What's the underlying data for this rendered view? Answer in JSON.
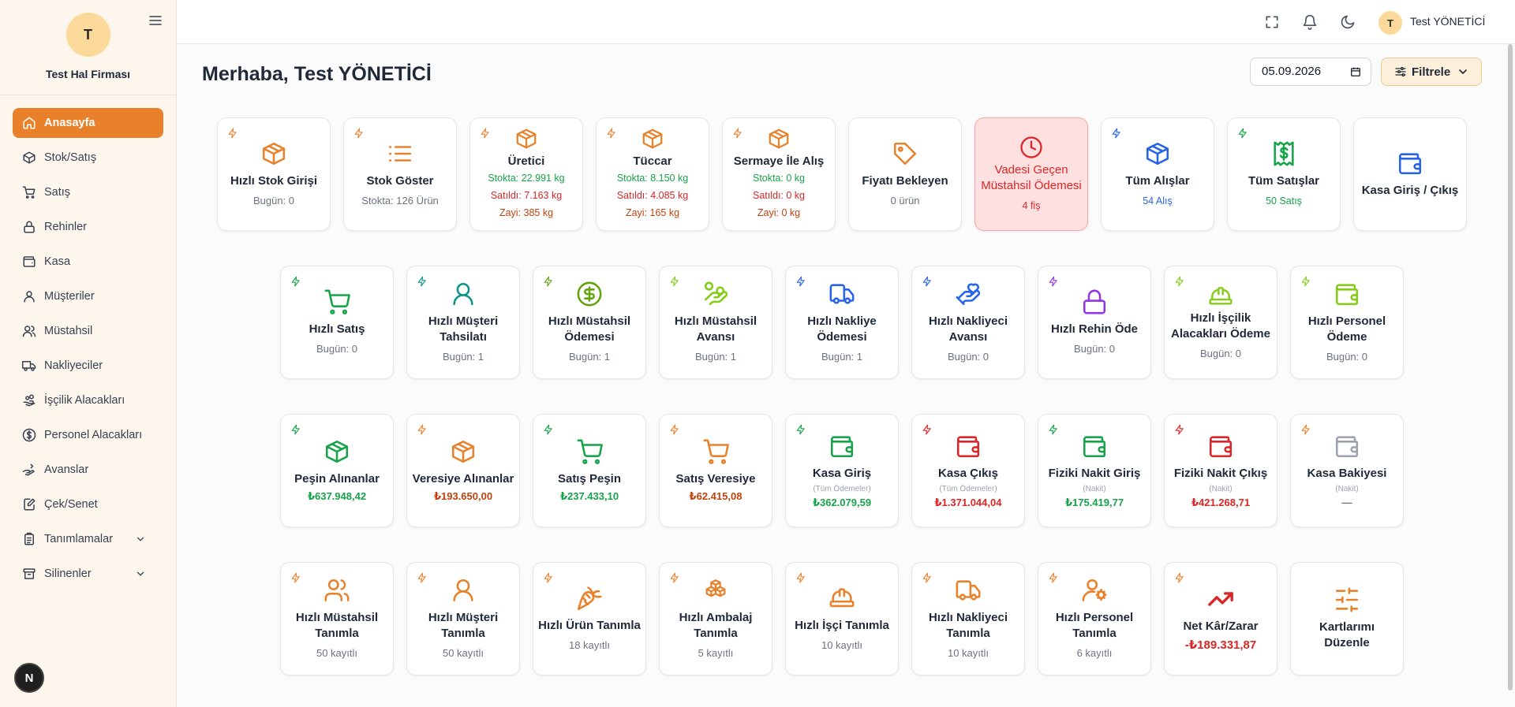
{
  "sidebar": {
    "company_initial": "T",
    "company_name": "Test Hal Firması",
    "items": [
      {
        "label": "Anasayfa"
      },
      {
        "label": "Stok/Satış"
      },
      {
        "label": "Satış"
      },
      {
        "label": "Rehinler"
      },
      {
        "label": "Kasa"
      },
      {
        "label": "Müşteriler"
      },
      {
        "label": "Müstahsil"
      },
      {
        "label": "Nakliyeciler"
      },
      {
        "label": "İşçilik Alacakları"
      },
      {
        "label": "Personel Alacakları"
      },
      {
        "label": "Avanslar"
      },
      {
        "label": "Çek/Senet"
      },
      {
        "label": "Tanımlamalar"
      },
      {
        "label": "Silinenler"
      }
    ],
    "dev_badge": "N"
  },
  "topbar": {
    "user_initial": "T",
    "user_name": "Test YÖNETİCİ"
  },
  "header": {
    "greeting": "Merhaba, Test YÖNETİCİ",
    "date": "05.09.2026",
    "filter_label": "Filtrele"
  },
  "colors": {
    "accent": "#e8812a",
    "orange_icon": "#e8812a",
    "green": "#16a34a",
    "red": "#dc2626",
    "blue": "#2563eb",
    "lime": "#84cc16",
    "teal": "#0d9488",
    "purple": "#9333ea"
  },
  "cards_row1": [
    {
      "title": "Hızlı Stok Girişi",
      "sub": "Bugün: 0",
      "icon": "box-icon"
    },
    {
      "title": "Stok Göster",
      "sub": "Stokta: 126 Ürün",
      "icon": "list-icon"
    },
    {
      "title": "Üretici",
      "stock": "Stokta: 22.991 kg",
      "sold": "Satıldı: 7.163 kg",
      "waste": "Zayi: 385 kg",
      "icon": "box-icon"
    },
    {
      "title": "Tüccar",
      "stock": "Stokta: 8.150 kg",
      "sold": "Satıldı: 4.085 kg",
      "waste": "Zayi: 165 kg",
      "icon": "box-icon"
    },
    {
      "title": "Sermaye İle Alış",
      "stock": "Stokta: 0 kg",
      "sold": "Satıldı: 0 kg",
      "waste": "Zayi: 0 kg",
      "icon": "box-icon"
    },
    {
      "title": "Fiyatı Bekleyen",
      "sub": "0 ürün",
      "icon": "tag-icon"
    },
    {
      "title": "Vadesi Geçen Müstahsil Ödemesi",
      "sub": "4 fiş",
      "icon": "clock-icon"
    },
    {
      "title": "Tüm Alışlar",
      "sub": "54 Alış",
      "icon": "box-icon"
    },
    {
      "title": "Tüm Satışlar",
      "sub": "50 Satış",
      "icon": "receipt-icon"
    },
    {
      "title": "Kasa Giriş / Çıkış",
      "icon": "wallet-icon"
    }
  ],
  "cards_row2": [
    {
      "title": "Hızlı Satış",
      "sub": "Bugün: 0",
      "icon": "cart-icon"
    },
    {
      "title": "Hızlı Müşteri Tahsilatı",
      "sub": "Bugün: 1",
      "icon": "user-icon"
    },
    {
      "title": "Hızlı Müstahsil Ödemesi",
      "sub": "Bugün: 1",
      "icon": "dollar-circle-icon"
    },
    {
      "title": "Hızlı Müstahsil Avansı",
      "sub": "Bugün: 1",
      "icon": "hand-coins-icon"
    },
    {
      "title": "Hızlı Nakliye Ödemesi",
      "sub": "Bugün: 1",
      "icon": "truck-icon"
    },
    {
      "title": "Hızlı Nakliyeci Avansı",
      "sub": "Bugün: 0",
      "icon": "hand-heart-icon"
    },
    {
      "title": "Hızlı Rehin Öde",
      "sub": "Bugün: 0",
      "icon": "lock-icon"
    },
    {
      "title": "Hızlı İşçilik Alacakları Ödeme",
      "sub": "Bugün: 0",
      "icon": "hard-hat-icon"
    },
    {
      "title": "Hızlı Personel Ödeme",
      "sub": "Bugün: 0",
      "icon": "wallet-icon"
    }
  ],
  "cards_row3": [
    {
      "title": "Peşin Alınanlar",
      "value": "₺637.948,42",
      "icon": "box-icon"
    },
    {
      "title": "Veresiye Alınanlar",
      "value": "₺193.650,00",
      "icon": "box-icon"
    },
    {
      "title": "Satış Peşin",
      "value": "₺237.433,10",
      "icon": "cart-icon"
    },
    {
      "title": "Satış Veresiye",
      "value": "₺62.415,08",
      "icon": "cart-icon"
    },
    {
      "title": "Kasa Giriş",
      "note": "(Tüm Ödemeler)",
      "value": "₺362.079,59",
      "icon": "wallet-icon"
    },
    {
      "title": "Kasa Çıkış",
      "note": "(Tüm Ödemeler)",
      "value": "₺1.371.044,04",
      "icon": "wallet-icon"
    },
    {
      "title": "Fiziki Nakit Giriş",
      "note": "(Nakit)",
      "value": "₺175.419,77",
      "icon": "wallet-icon"
    },
    {
      "title": "Fiziki Nakit Çıkış",
      "note": "(Nakit)",
      "value": "₺421.268,71",
      "icon": "wallet-icon"
    },
    {
      "title": "Kasa Bakiyesi",
      "note": "(Nakit)",
      "value": "—",
      "icon": "wallet-icon"
    }
  ],
  "cards_row4": [
    {
      "title": "Hızlı Müstahsil Tanımla",
      "sub": "50 kayıtlı",
      "icon": "users-icon"
    },
    {
      "title": "Hızlı Müşteri Tanımla",
      "sub": "50 kayıtlı",
      "icon": "user-icon"
    },
    {
      "title": "Hızlı Ürün Tanımla",
      "sub": "18 kayıtlı",
      "icon": "carrot-icon"
    },
    {
      "title": "Hızlı Ambalaj Tanımla",
      "sub": "5 kayıtlı",
      "icon": "boxes-icon"
    },
    {
      "title": "Hızlı İşçi Tanımla",
      "sub": "10 kayıtlı",
      "icon": "hard-hat-icon"
    },
    {
      "title": "Hızlı Nakliyeci Tanımla",
      "sub": "10 kayıtlı",
      "icon": "truck-icon"
    },
    {
      "title": "Hızlı Personel Tanımla",
      "sub": "6 kayıtlı",
      "icon": "user-cog-icon"
    },
    {
      "title": "Net Kâr/Zarar",
      "value": "-₺189.331,87",
      "icon": "trending-up-icon"
    },
    {
      "title": "Kartlarımı Düzenle",
      "icon": "sliders-icon"
    }
  ]
}
